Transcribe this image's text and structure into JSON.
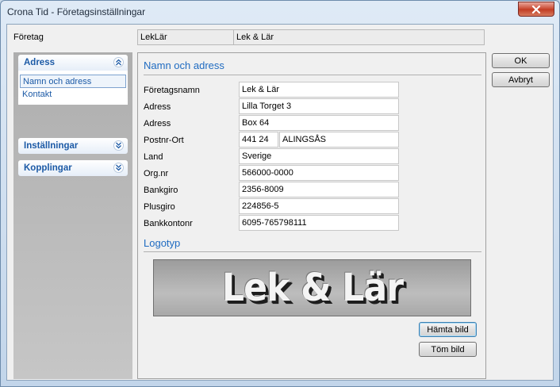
{
  "window": {
    "title": "Crona Tid - Företagsinställningar"
  },
  "firm": {
    "label": "Företag",
    "code": "LekLär",
    "name": "Lek & Lär"
  },
  "nav": {
    "groups": [
      {
        "label": "Adress",
        "expanded": true,
        "items": [
          {
            "label": "Namn och adress",
            "selected": true
          },
          {
            "label": "Kontakt",
            "selected": false
          }
        ]
      },
      {
        "label": "Inställningar",
        "expanded": false
      },
      {
        "label": "Kopplingar",
        "expanded": false
      }
    ]
  },
  "section_address": {
    "title": "Namn och adress"
  },
  "fields": {
    "company_name": {
      "label": "Företagsnamn",
      "value": "Lek & Lär"
    },
    "address1": {
      "label": "Adress",
      "value": "Lilla Torget 3"
    },
    "address2": {
      "label": "Adress",
      "value": "Box 64"
    },
    "postal": {
      "label": "Postnr-Ort",
      "zip": "441 24",
      "city": "ALINGSÅS"
    },
    "country": {
      "label": "Land",
      "value": "Sverige"
    },
    "org_nr": {
      "label": "Org.nr",
      "value": "566000-0000"
    },
    "bankgiro": {
      "label": "Bankgiro",
      "value": "2356-8009"
    },
    "plusgiro": {
      "label": "Plusgiro",
      "value": "224856-5"
    },
    "bank_account": {
      "label": "Bankkontonr",
      "value": "6095-765798111"
    }
  },
  "section_logo": {
    "title": "Logotyp",
    "logo_text": "Lek & Lär"
  },
  "buttons": {
    "ok": "OK",
    "cancel": "Avbryt",
    "fetch_image": "Hämta bild",
    "clear_image": "Töm bild"
  },
  "icons": {
    "close": "close-icon",
    "collapse": "chevron-double-up-icon",
    "expand": "chevron-double-down-icon"
  }
}
